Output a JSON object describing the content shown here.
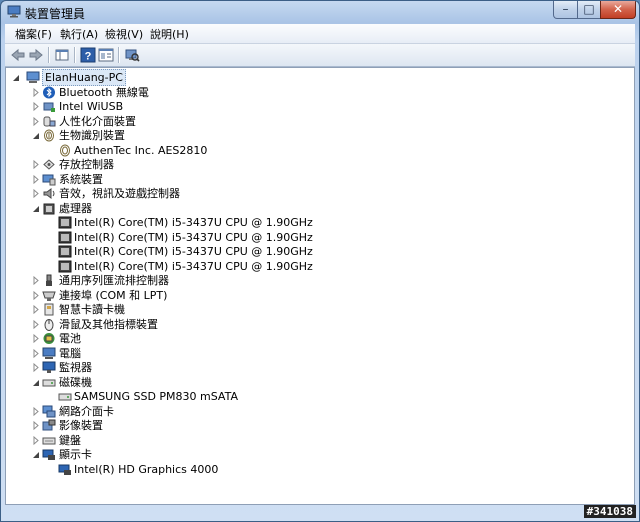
{
  "window": {
    "title": "裝置管理員"
  },
  "caption_buttons": {
    "minimize": "–",
    "maximize": "□",
    "close": "✕"
  },
  "menu": [
    "檔案(F)",
    "執行(A)",
    "檢視(V)",
    "說明(H)"
  ],
  "toolbar": {
    "buttons": [
      "back-arrow-icon",
      "forward-arrow-icon",
      "show-hide-console-tree-icon",
      "help-icon",
      "properties-icon",
      "scan-hardware-icon"
    ]
  },
  "tree": {
    "root": "ElanHuang-PC",
    "nodes": [
      {
        "label": "Bluetooth 無線電",
        "icon": "bluetooth-icon",
        "expanded": false
      },
      {
        "label": "Intel WiUSB",
        "icon": "network-device-icon",
        "expanded": false
      },
      {
        "label": "人性化介面裝置",
        "icon": "hid-icon",
        "expanded": false
      },
      {
        "label": "生物識別裝置",
        "icon": "fingerprint-icon",
        "expanded": true,
        "children": [
          "AuthenTec Inc. AES2810"
        ]
      },
      {
        "label": "存放控制器",
        "icon": "storage-controller-icon",
        "expanded": false
      },
      {
        "label": "系統裝置",
        "icon": "system-device-icon",
        "expanded": false
      },
      {
        "label": "音效，視訊及遊戲控制器",
        "icon": "speaker-icon",
        "expanded": false
      },
      {
        "label": "處理器",
        "icon": "processor-icon",
        "expanded": true,
        "children": [
          "Intel(R) Core(TM) i5-3437U CPU @ 1.90GHz",
          "Intel(R) Core(TM) i5-3437U CPU @ 1.90GHz",
          "Intel(R) Core(TM) i5-3437U CPU @ 1.90GHz",
          "Intel(R) Core(TM) i5-3437U CPU @ 1.90GHz"
        ]
      },
      {
        "label": "通用序列匯流排控制器",
        "icon": "usb-icon",
        "expanded": false
      },
      {
        "label": "連接埠 (COM 和 LPT)",
        "icon": "port-icon",
        "expanded": false
      },
      {
        "label": "智慧卡讀卡機",
        "icon": "smartcard-icon",
        "expanded": false
      },
      {
        "label": "滑鼠及其他指標裝置",
        "icon": "mouse-icon",
        "expanded": false
      },
      {
        "label": "電池",
        "icon": "battery-icon",
        "expanded": false
      },
      {
        "label": "電腦",
        "icon": "computer-icon",
        "expanded": false
      },
      {
        "label": "監視器",
        "icon": "monitor-icon",
        "expanded": false
      },
      {
        "label": "磁碟機",
        "icon": "disk-drive-icon",
        "expanded": true,
        "children": [
          "SAMSUNG SSD PM830 mSATA"
        ]
      },
      {
        "label": "網路介面卡",
        "icon": "network-adapter-icon",
        "expanded": false
      },
      {
        "label": "影像裝置",
        "icon": "camera-icon",
        "expanded": false
      },
      {
        "label": "鍵盤",
        "icon": "keyboard-icon",
        "expanded": false
      },
      {
        "label": "顯示卡",
        "icon": "display-adapter-icon",
        "expanded": true,
        "children": [
          "Intel(R) HD Graphics 4000"
        ]
      }
    ]
  },
  "watermark": "#341038"
}
